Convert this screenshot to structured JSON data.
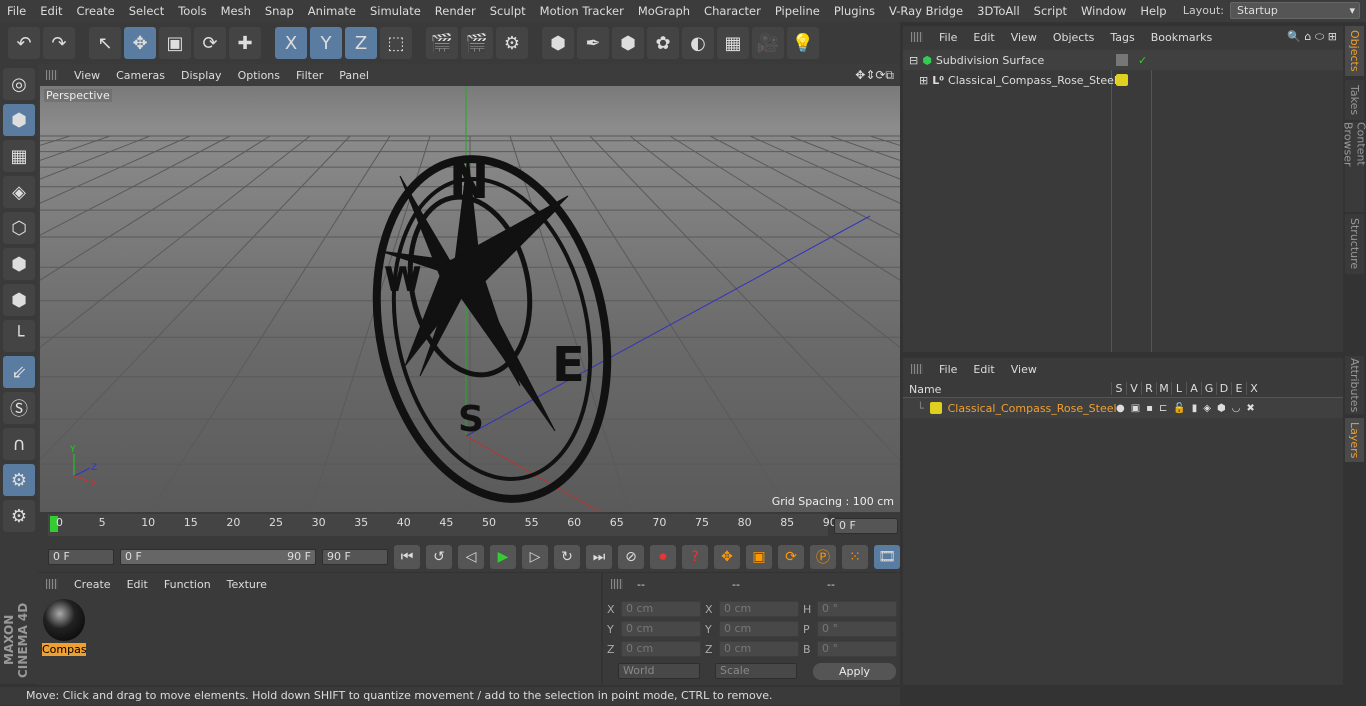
{
  "menu": [
    "File",
    "Edit",
    "Create",
    "Select",
    "Tools",
    "Mesh",
    "Snap",
    "Animate",
    "Simulate",
    "Render",
    "Sculpt",
    "Motion Tracker",
    "MoGraph",
    "Character",
    "Pipeline",
    "Plugins",
    "V-Ray Bridge",
    "3DToAll",
    "Script",
    "Window",
    "Help"
  ],
  "layout": {
    "label": "Layout:",
    "value": "Startup"
  },
  "toolbar_icons": [
    "undo-icon",
    "redo-icon",
    "select-icon",
    "move-icon",
    "scale-icon",
    "rotate-icon",
    "move-all-icon",
    "x-axis-icon",
    "y-axis-icon",
    "z-axis-icon",
    "coordinate-system-icon",
    "render-view-icon",
    "render-picture-viewer-icon",
    "render-settings-icon",
    "cube-icon",
    "pen-icon",
    "subdivision-icon",
    "cloner-icon",
    "deformer-icon",
    "floor-icon",
    "camera-icon",
    "light-icon"
  ],
  "toolbar_glyphs": [
    "↶",
    "↷",
    "↖",
    "✥",
    "▣",
    "⟳",
    "✚",
    "X",
    "Y",
    "Z",
    "⬚",
    "🎬",
    "🎬",
    "⚙",
    "⬢",
    "✒",
    "⬢",
    "✿",
    "◐",
    "▦",
    "🎥",
    "💡"
  ],
  "left_icons": [
    "make-editable-icon",
    "model-mode-icon",
    "texture-mode-icon",
    "workplane-icon",
    "point-mode-icon",
    "edge-mode-icon",
    "polygon-mode-icon",
    "axis-icon",
    "tweak-icon",
    "solo-icon",
    "magnet-icon",
    "snap-icon",
    "snap-settings-icon"
  ],
  "viewport": {
    "menu": [
      "View",
      "Cameras",
      "Display",
      "Options",
      "Filter",
      "Panel"
    ],
    "camera": "Perspective",
    "grid_spacing": "Grid Spacing : 100 cm",
    "compass_letters": [
      "N",
      "E",
      "S",
      "W"
    ],
    "axis_labels": [
      "Y",
      "Z",
      "X"
    ]
  },
  "timeline": {
    "ticks": [
      "0",
      "5",
      "10",
      "15",
      "20",
      "25",
      "30",
      "35",
      "40",
      "45",
      "50",
      "55",
      "60",
      "65",
      "70",
      "75",
      "80",
      "85",
      "90"
    ],
    "current_frame": "0 F"
  },
  "controls": {
    "start": "0 F",
    "range_start": "0 F",
    "range_end": "90 F",
    "end": "90 F",
    "max": "90 F"
  },
  "materials": {
    "menu": [
      "Create",
      "Edit",
      "Function",
      "Texture"
    ],
    "items": [
      {
        "name": "Compas"
      }
    ]
  },
  "coords": {
    "headers": [
      "--",
      "--",
      "--"
    ],
    "rows": [
      [
        "X",
        "0 cm",
        "X",
        "0 cm",
        "H",
        "0 °"
      ],
      [
        "Y",
        "0 cm",
        "Y",
        "0 cm",
        "P",
        "0 °"
      ],
      [
        "Z",
        "0 cm",
        "Z",
        "0 cm",
        "B",
        "0 °"
      ]
    ],
    "world": "World",
    "scale": "Scale",
    "apply": "Apply"
  },
  "status": "Move: Click and drag to move elements. Hold down SHIFT to quantize movement / add to the selection in point mode, CTRL to remove.",
  "objects": {
    "menu": [
      "File",
      "Edit",
      "View",
      "Objects",
      "Tags",
      "Bookmarks"
    ],
    "items": [
      "Subdivision Surface",
      "Classical_Compass_Rose_Steel"
    ]
  },
  "layers": {
    "menu": [
      "File",
      "Edit",
      "View"
    ],
    "name_header": "Name",
    "columns": [
      "S",
      "V",
      "R",
      "M",
      "L",
      "A",
      "G",
      "D",
      "E",
      "X"
    ],
    "items": [
      "Classical_Compass_Rose_Steel"
    ],
    "layer_color": "#e0d020",
    "name_color": "#f0a030"
  },
  "side_tabs": [
    "Objects",
    "Takes",
    "Content Browser",
    "Structure",
    "Attributes",
    "Layers"
  ],
  "logo": "MAXON CINEMA 4D"
}
